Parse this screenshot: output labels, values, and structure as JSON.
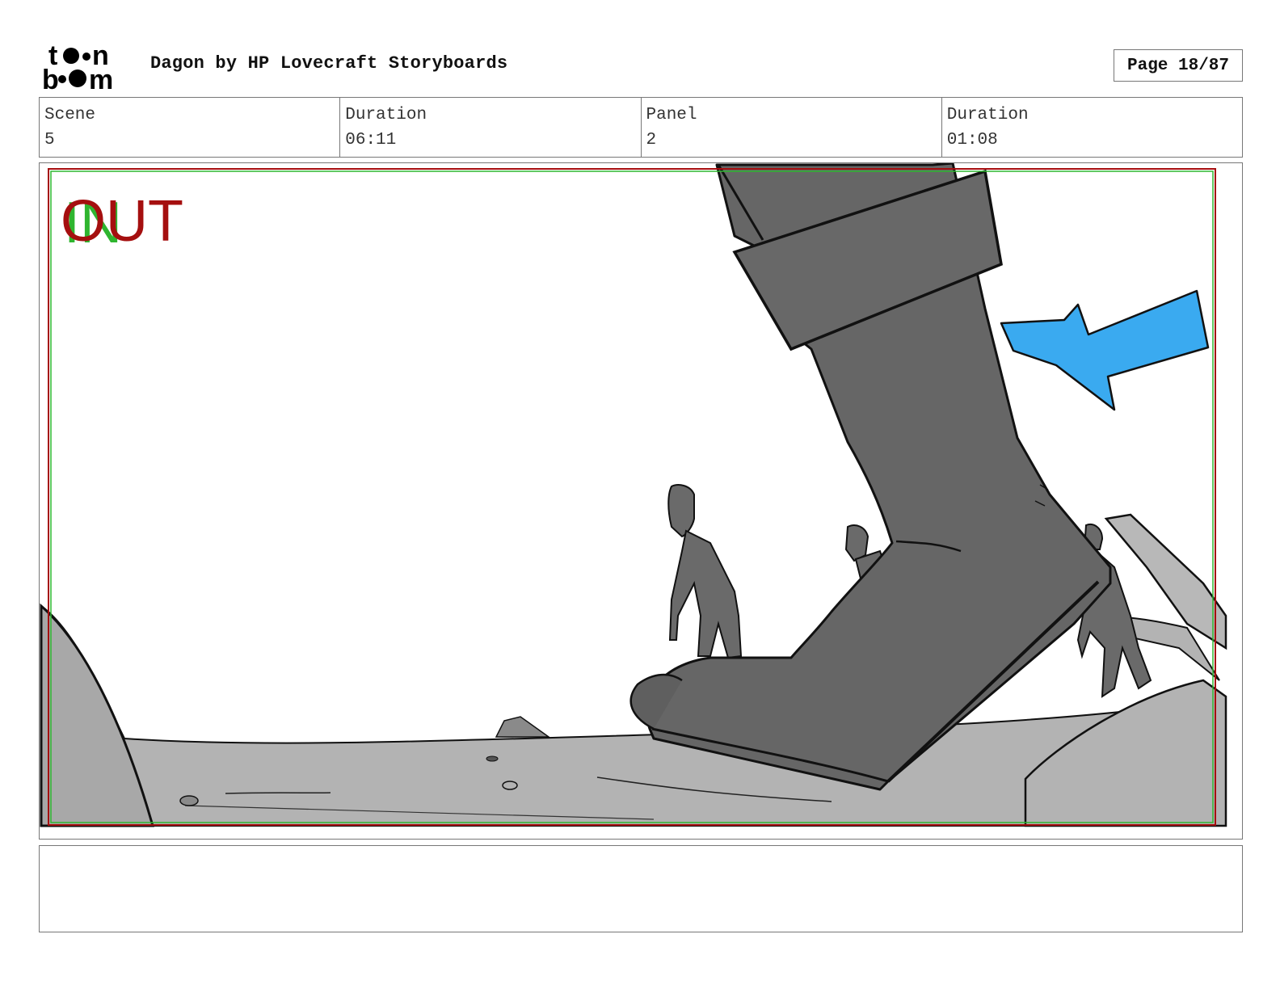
{
  "header": {
    "logo_text_top": "toon",
    "logo_text_bottom": "boom",
    "title": "Dagon by HP Lovecraft Storyboards",
    "page_label": "Page 18/87"
  },
  "info": [
    {
      "label": "Scene",
      "value": "5"
    },
    {
      "label": "Duration",
      "value": "06:11"
    },
    {
      "label": "Panel",
      "value": "2"
    },
    {
      "label": "Duration",
      "value": "01:08"
    }
  ],
  "panel": {
    "overlay_in": "IN",
    "overlay_out": "OUT",
    "colors": {
      "out_text": "#a50f0f",
      "in_text": "#2fb52f",
      "arrow": "#3aaaf0",
      "boot": "#666666",
      "ground": "#b3b3b3",
      "figures": "#6a6a6a"
    }
  },
  "notes": {
    "text": ""
  }
}
